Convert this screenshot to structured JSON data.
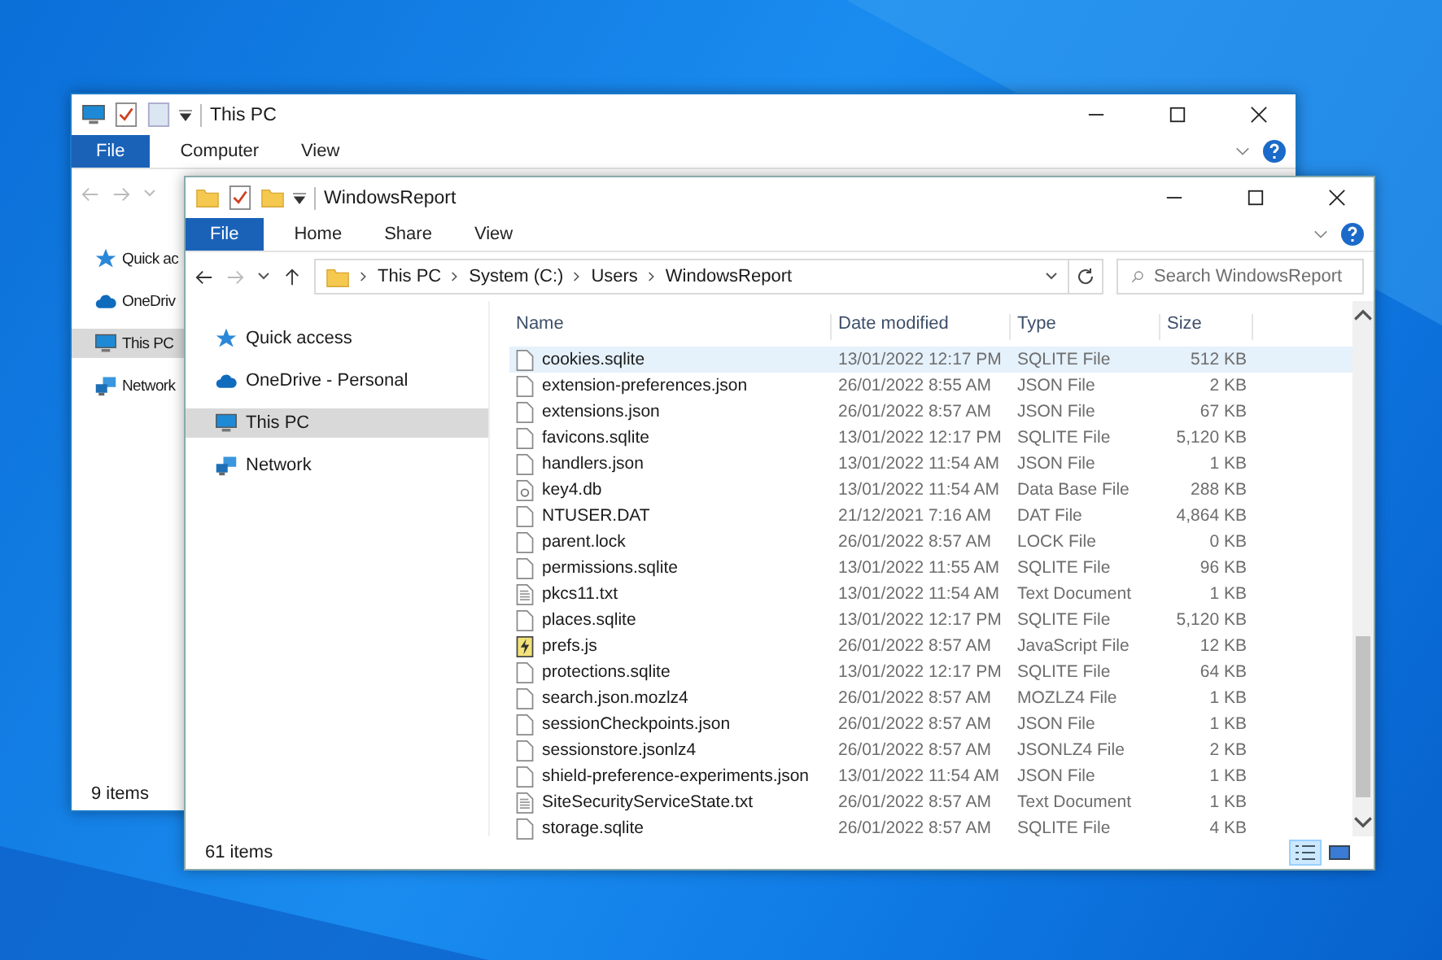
{
  "back_window": {
    "title": "This PC",
    "ribbon_tabs": [
      {
        "label": "File",
        "kind": "file"
      },
      {
        "label": "Computer",
        "kind": "tab"
      },
      {
        "label": "View",
        "kind": "tab"
      }
    ],
    "nav_items": [
      {
        "label": "Quick ac",
        "kind": "star",
        "selected": false
      },
      {
        "label": "OneDriv",
        "kind": "cloud",
        "selected": false
      },
      {
        "label": "This PC",
        "kind": "pc",
        "selected": true
      },
      {
        "label": "Network",
        "kind": "network",
        "selected": false
      }
    ],
    "status": "9 items"
  },
  "front_window": {
    "title": "WindowsReport",
    "ribbon_tabs": [
      {
        "label": "File",
        "kind": "file"
      },
      {
        "label": "Home",
        "kind": "tab"
      },
      {
        "label": "Share",
        "kind": "tab"
      },
      {
        "label": "View",
        "kind": "tab"
      }
    ],
    "breadcrumb": [
      "This PC",
      "System (C:)",
      "Users",
      "WindowsReport"
    ],
    "search": {
      "placeholder": "Search WindowsReport"
    },
    "nav_items": [
      {
        "label": "Quick access",
        "kind": "star",
        "selected": false
      },
      {
        "label": "OneDrive - Personal",
        "kind": "cloud",
        "selected": false
      },
      {
        "label": "This PC",
        "kind": "pc",
        "selected": true
      },
      {
        "label": "Network",
        "kind": "network",
        "selected": false
      }
    ],
    "columns": [
      "Name",
      "Date modified",
      "Type",
      "Size"
    ],
    "rows": [
      {
        "name": "cookies.sqlite",
        "date": "13/01/2022 12:17 PM",
        "type": "SQLITE File",
        "size": "512 KB",
        "kind": "file",
        "selected": true
      },
      {
        "name": "extension-preferences.json",
        "date": "26/01/2022 8:55 AM",
        "type": "JSON File",
        "size": "2 KB",
        "kind": "file",
        "selected": false
      },
      {
        "name": "extensions.json",
        "date": "26/01/2022 8:57 AM",
        "type": "JSON File",
        "size": "67 KB",
        "kind": "file",
        "selected": false
      },
      {
        "name": "favicons.sqlite",
        "date": "13/01/2022 12:17 PM",
        "type": "SQLITE File",
        "size": "5,120 KB",
        "kind": "file",
        "selected": false
      },
      {
        "name": "handlers.json",
        "date": "13/01/2022 11:54 AM",
        "type": "JSON File",
        "size": "1 KB",
        "kind": "file",
        "selected": false
      },
      {
        "name": "key4.db",
        "date": "13/01/2022 11:54 AM",
        "type": "Data Base File",
        "size": "288 KB",
        "kind": "db",
        "selected": false
      },
      {
        "name": "NTUSER.DAT",
        "date": "21/12/2021 7:16 AM",
        "type": "DAT File",
        "size": "4,864 KB",
        "kind": "file",
        "selected": false
      },
      {
        "name": "parent.lock",
        "date": "26/01/2022 8:57 AM",
        "type": "LOCK File",
        "size": "0 KB",
        "kind": "file",
        "selected": false
      },
      {
        "name": "permissions.sqlite",
        "date": "13/01/2022 11:55 AM",
        "type": "SQLITE File",
        "size": "96 KB",
        "kind": "file",
        "selected": false
      },
      {
        "name": "pkcs11.txt",
        "date": "13/01/2022 11:54 AM",
        "type": "Text Document",
        "size": "1 KB",
        "kind": "text",
        "selected": false
      },
      {
        "name": "places.sqlite",
        "date": "13/01/2022 12:17 PM",
        "type": "SQLITE File",
        "size": "5,120 KB",
        "kind": "file",
        "selected": false
      },
      {
        "name": "prefs.js",
        "date": "26/01/2022 8:57 AM",
        "type": "JavaScript File",
        "size": "12 KB",
        "kind": "script",
        "selected": false
      },
      {
        "name": "protections.sqlite",
        "date": "13/01/2022 12:17 PM",
        "type": "SQLITE File",
        "size": "64 KB",
        "kind": "file",
        "selected": false
      },
      {
        "name": "search.json.mozlz4",
        "date": "26/01/2022 8:57 AM",
        "type": "MOZLZ4 File",
        "size": "1 KB",
        "kind": "file",
        "selected": false
      },
      {
        "name": "sessionCheckpoints.json",
        "date": "26/01/2022 8:57 AM",
        "type": "JSON File",
        "size": "1 KB",
        "kind": "file",
        "selected": false
      },
      {
        "name": "sessionstore.jsonlz4",
        "date": "26/01/2022 8:57 AM",
        "type": "JSONLZ4 File",
        "size": "2 KB",
        "kind": "file",
        "selected": false
      },
      {
        "name": "shield-preference-experiments.json",
        "date": "13/01/2022 11:54 AM",
        "type": "JSON File",
        "size": "1 KB",
        "kind": "file",
        "selected": false
      },
      {
        "name": "SiteSecurityServiceState.txt",
        "date": "26/01/2022 8:57 AM",
        "type": "Text Document",
        "size": "1 KB",
        "kind": "text",
        "selected": false
      },
      {
        "name": "storage.sqlite",
        "date": "26/01/2022 8:57 AM",
        "type": "SQLITE File",
        "size": "4 KB",
        "kind": "file",
        "selected": false
      }
    ],
    "status": "61 items"
  }
}
